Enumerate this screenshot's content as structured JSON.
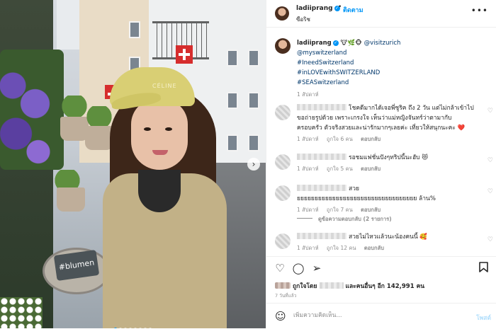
{
  "post": {
    "username": "ladiiprang",
    "follow_label": "ติดตาม",
    "location": "ซือริช",
    "more_label": "•••",
    "caption": {
      "emojis": "🐮🌿🐵",
      "mention_1": "@visitzurich",
      "mention_2": "@myswitzerland",
      "hashtags": [
        "#IneedSwitzerland",
        "#inLOVEwithSWITZERLAND",
        "#SEASwitzerland"
      ],
      "time": "1 สัปดาห์"
    },
    "image": {
      "cap_text": "CÉLINE",
      "sign_text": "#blumen",
      "carousel_count": 8,
      "carousel_active": 1
    }
  },
  "comments": [
    {
      "text": "โชคดีมากได้เจอพี่ซูริค ถึง 2 วัน แต่ไม่กล้าเข้าไปขอถ่ายรูปด้วย เพราะเกรงใจ เห็นว่าแม่หญิงจันทร์ว่าตามากับครอบครัว ตัวจริงสวยและน่ารักมากๆเลยค่ะ เที่ยวให้สนุกนะคะ ❤️",
      "time": "1 สัปดาห์",
      "likes": "ถูกใจ 6 คน",
      "reply": "ตอบกลับ"
    },
    {
      "text": "รอชมแฟชั่นปังๆทริปนี้นะฮับ 😻",
      "time": "1 สัปดาห์",
      "likes": "ถูกใจ 5 คน",
      "reply": "ตอบกลับ"
    },
    {
      "text": "สวยยยยยยยยยยยยยยยยยยยยยยยยยยยยยยยยยยย ล้าน%",
      "time": "1 สัปดาห์",
      "likes": "ถูกใจ 7 คน",
      "reply": "ตอบกลับ",
      "view_replies": "ดูข้อความตอบกลับ (2 รายการ)"
    },
    {
      "text": "สวยไม่ไหวแล้วนะน้องคนนี้ 🥰",
      "time": "1 สัปดาห์",
      "likes": "ถูกใจ 12 คน",
      "reply": "ตอบกลับ"
    }
  ],
  "actions": {
    "like_icon": "heart-icon",
    "comment_icon": "comment-icon",
    "share_icon": "share-icon",
    "save_icon": "bookmark-icon"
  },
  "likes_summary": {
    "prefix": "ถูกใจโดย",
    "suffix": "และคนอื่นๆ อีก 142,991 คน"
  },
  "post_date": "7 วันที่แล้ว",
  "add_comment": {
    "placeholder": "เพิ่มความคิดเห็น...",
    "post_label": "โพสต์"
  },
  "colors": {
    "accent": "#0095f6",
    "link": "#00376b",
    "muted": "#8e8e8e",
    "heart_red": "#ed4956"
  }
}
